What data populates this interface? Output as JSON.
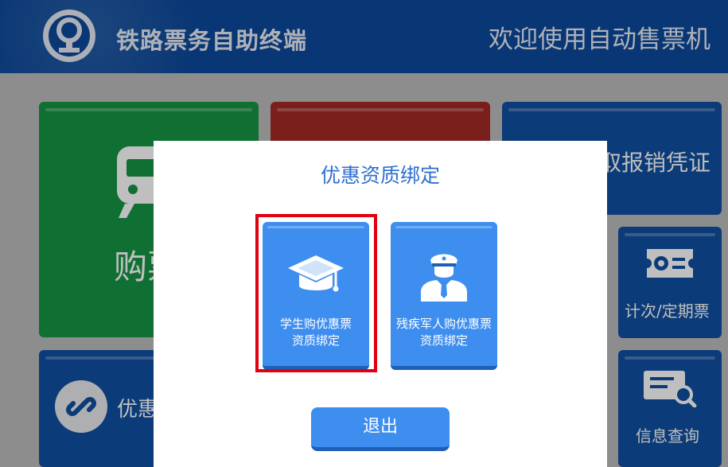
{
  "header": {
    "app_title": "铁路票务自助终端",
    "welcome_text": "欢迎使用自动售票机"
  },
  "tiles": {
    "buy": "购票",
    "invoice": "取报销凭证",
    "discount": "优惠",
    "period": "计次/定期票",
    "query": "信息查询"
  },
  "dialog": {
    "title": "优惠资质绑定",
    "options": [
      {
        "line1": "学生购优惠票",
        "line2": "资质绑定",
        "icon": "graduation-cap-icon",
        "highlighted": true
      },
      {
        "line1": "残疾军人购优惠票",
        "line2": "资质绑定",
        "icon": "officer-icon",
        "highlighted": false
      }
    ],
    "exit_label": "退出"
  },
  "colors": {
    "header": "#0d4a9c",
    "buy_tile": "#169443",
    "change_tile": "#a52a26",
    "blue_tile": "#0f4fa0",
    "button": "#3e8ef0",
    "title_text": "#2e6fd0",
    "highlight_border": "#e0000f"
  }
}
